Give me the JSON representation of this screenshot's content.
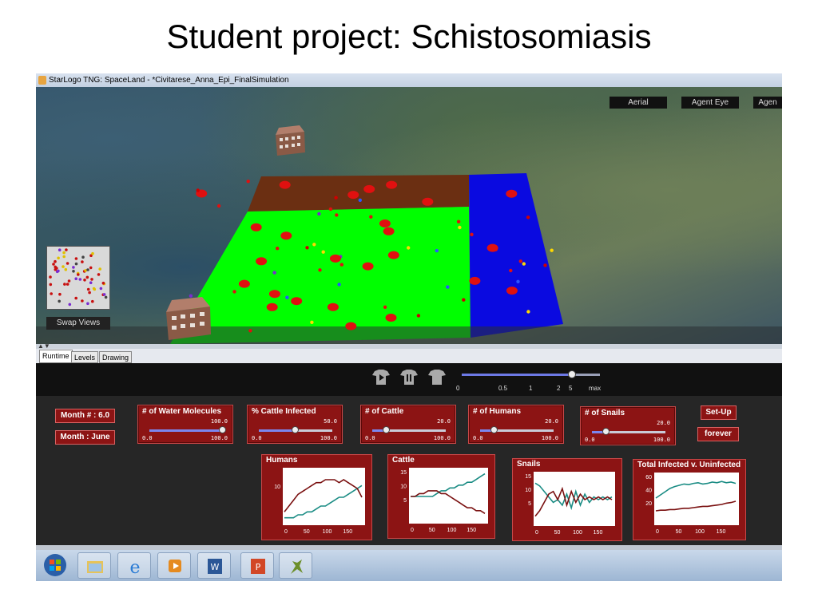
{
  "slide": {
    "title": "Student project: Schistosomiasis"
  },
  "window": {
    "title": "StarLogo TNG: SpaceLand - *Civitarese_Anna_Epi_FinalSimulation"
  },
  "viewport": {
    "view_buttons": [
      "Aerial",
      "Agent Eye",
      "Agen"
    ],
    "swap_views_label": "Swap Views"
  },
  "tabs": [
    "Runtime",
    "Levels",
    "Drawing"
  ],
  "speed": {
    "ticks": [
      "0",
      "0.5",
      "1",
      "2",
      "5",
      "max"
    ],
    "value_fraction": 0.8
  },
  "buttons": {
    "month_num": "Month # : 6.0",
    "month_name": "Month : June",
    "setup": "Set-Up",
    "forever": "forever"
  },
  "sliders": [
    {
      "label": "# of Water Molecules",
      "value": "100.0",
      "min": "0.0",
      "max": "100.0",
      "fraction": 1.0
    },
    {
      "label": "% Cattle Infected",
      "value": "50.0",
      "min": "0.0",
      "max": "100.0",
      "fraction": 0.5
    },
    {
      "label": "# of Cattle",
      "value": "20.0",
      "min": "0.0",
      "max": "100.0",
      "fraction": 0.2
    },
    {
      "label": "# of Humans",
      "value": "20.0",
      "min": "0.0",
      "max": "100.0",
      "fraction": 0.2
    },
    {
      "label": "# of Snails",
      "value": "20.0",
      "min": "0.0",
      "max": "100.0",
      "fraction": 0.2
    }
  ],
  "graphs": [
    {
      "label": "Humans",
      "yticks": [
        "",
        "10",
        "",
        ""
      ],
      "xticks": [
        "0",
        "50",
        "100",
        "150"
      ]
    },
    {
      "label": "Cattle",
      "yticks": [
        "15",
        "10",
        "5",
        ""
      ],
      "xticks": [
        "0",
        "50",
        "100",
        "150"
      ]
    },
    {
      "label": "Snails",
      "yticks": [
        "15",
        "10",
        "5",
        ""
      ],
      "xticks": [
        "0",
        "50",
        "100",
        "150"
      ]
    },
    {
      "label": "Total Infected v. Uninfected",
      "yticks": [
        "60",
        "40",
        "20",
        ""
      ],
      "xticks": [
        "0",
        "50",
        "100",
        "150"
      ]
    }
  ],
  "colors": {
    "panel_red": "#8c1414",
    "field_green": "#00ff00",
    "field_brown": "#6b2f12",
    "field_blue": "#0a0ae0",
    "series_teal": "#1a8c84",
    "series_maroon": "#7a1010"
  },
  "taskbar": {
    "icons": [
      "windows-start-icon",
      "file-explorer-icon",
      "internet-explorer-icon",
      "media-player-icon",
      "word-icon",
      "powerpoint-icon",
      "starlogo-icon"
    ]
  }
}
